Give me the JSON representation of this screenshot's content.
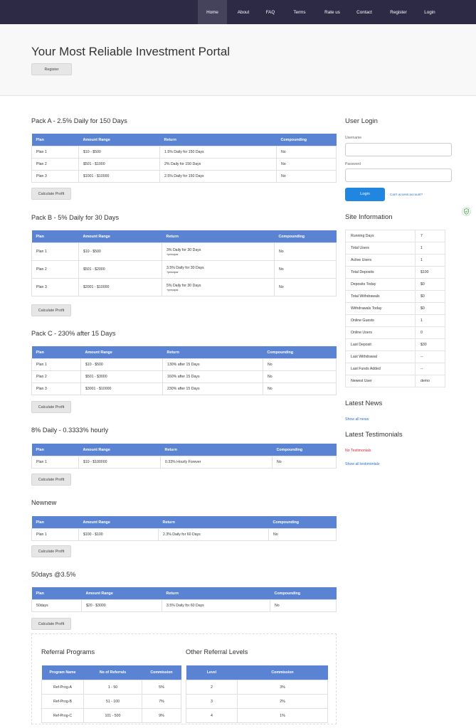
{
  "nav": {
    "items": [
      "Home",
      "About",
      "FAQ",
      "Terms",
      "Rate us",
      "Contact",
      "Register",
      "Login"
    ],
    "active": "Home"
  },
  "hero": {
    "title": "Your Most Reliable Investment Portal",
    "register_label": "Register"
  },
  "plans": [
    {
      "title": "Pack A - 2.5% Daily for 150 Days",
      "headers": [
        "Plan",
        "Amount Range",
        "Return",
        "Compounding"
      ],
      "rows": [
        {
          "plan": "Plan 1",
          "range": "$10 - $500",
          "return": "1.5% Daily for 150 Days",
          "note": "",
          "compounding": "No"
        },
        {
          "plan": "Plan 2",
          "range": "$501 - $1000",
          "return": "2% Daily for 150 Days",
          "note": "",
          "compounding": "No"
        },
        {
          "plan": "Plan 3",
          "range": "$1001 - $10000",
          "return": "2.5% Daily for 150 Days",
          "note": "",
          "compounding": "No"
        }
      ],
      "calc_label": "Calculate Profit"
    },
    {
      "title": "Pack B - 5% Daily for 30 Days",
      "headers": [
        "Plan",
        "Amount Range",
        "Return",
        "Compounding"
      ],
      "rows": [
        {
          "plan": "Plan 1",
          "range": "$10 - $500",
          "return": "3% Daily for 30 Days",
          "note": "+principal",
          "compounding": "No"
        },
        {
          "plan": "Plan 2",
          "range": "$501 - $2000",
          "return": "3.5% Daily for 30 Days",
          "note": "+principal",
          "compounding": "No"
        },
        {
          "plan": "Plan 3",
          "range": "$2001 - $10000",
          "return": "5% Daily for 30 Days",
          "note": "+principal",
          "compounding": "No"
        }
      ],
      "calc_label": "Calculate Profit"
    },
    {
      "title": "Pack C - 230% after 15 Days",
      "headers": [
        "Plan",
        "Amount Range",
        "Return",
        "Compounding"
      ],
      "rows": [
        {
          "plan": "Plan 1",
          "range": "$10 - $500",
          "return": "130% after 15 Days",
          "note": "",
          "compounding": "No"
        },
        {
          "plan": "Plan 2",
          "range": "$501 - $3000",
          "return": "160% after 15 Days",
          "note": "",
          "compounding": "No"
        },
        {
          "plan": "Plan 3",
          "range": "$3001 - $10000",
          "return": "230% after 15 Days",
          "note": "",
          "compounding": "No"
        }
      ],
      "calc_label": "Calculate Profit"
    },
    {
      "title": "8% Daily - 0.3333% hourly",
      "headers": [
        "Plan",
        "Amount Range",
        "Return",
        "Compounding"
      ],
      "rows": [
        {
          "plan": "Plan 1",
          "range": "$10 - $100000",
          "return": "0.33% Hourly Forever",
          "note": "",
          "compounding": "No"
        }
      ],
      "calc_label": "Calculate Profit"
    },
    {
      "title": "Newnew",
      "headers": [
        "Plan",
        "Amount Range",
        "Return",
        "Compounding"
      ],
      "rows": [
        {
          "plan": "Plan 1",
          "range": "$100 - $100",
          "return": "2.3% Daily for 60 Days",
          "note": "",
          "compounding": "No"
        }
      ],
      "calc_label": "Calculate Profit"
    },
    {
      "title": "50days @3.5%",
      "headers": [
        "Plan",
        "Amount Range",
        "Return",
        "Compounding"
      ],
      "rows": [
        {
          "plan": "50days",
          "range": "$20 - $3000",
          "return": "3.5% Daily for 60 Days",
          "note": "",
          "compounding": "No"
        }
      ],
      "calc_label": "Calculate Profit"
    }
  ],
  "login": {
    "title": "User Login",
    "username_label": "Username",
    "password_label": "Password",
    "button_label": "Login",
    "cant_access": "Can't access account?"
  },
  "site_info": {
    "title": "Site Information",
    "rows": [
      {
        "label": "Running Days",
        "value": "7"
      },
      {
        "label": "Total Users",
        "value": "1"
      },
      {
        "label": "Active Users",
        "value": "1"
      },
      {
        "label": "Total Deposits",
        "value": "$100"
      },
      {
        "label": "Deposits Today",
        "value": "$0"
      },
      {
        "label": "Total Withdrawals",
        "value": "$0"
      },
      {
        "label": "Withdrawals Today",
        "value": "$0"
      },
      {
        "label": "Online Guests",
        "value": "1"
      },
      {
        "label": "Online Users",
        "value": "0"
      },
      {
        "label": "Last Deposit",
        "value": "$30"
      },
      {
        "label": "Last Withdrawal",
        "value": "--"
      },
      {
        "label": "Last Funds Added",
        "value": "--"
      },
      {
        "label": "Newest User",
        "value": "demo"
      }
    ]
  },
  "news": {
    "title": "Latest News",
    "show_all": "Show all news"
  },
  "testimonials": {
    "title": "Latest Testimonials",
    "empty": "No Testimonials",
    "show_all": "Show all testimonials"
  },
  "referral": {
    "title": "Referral Programs",
    "headers": [
      "Program Name",
      "No of Referrals",
      "Commission"
    ],
    "rows": [
      [
        "Ref-Prog-A",
        "1 - 50",
        "5%"
      ],
      [
        "Ref-Prog-B",
        "51 - 100",
        "7%"
      ],
      [
        "Ref-Prog-C",
        "101 - 500",
        "9%"
      ]
    ]
  },
  "other_levels": {
    "title": "Other Referral Levels",
    "headers": [
      "Level",
      "Commission"
    ],
    "rows": [
      [
        "2",
        "3%"
      ],
      [
        "3",
        "2%"
      ],
      [
        "4",
        "1%"
      ]
    ]
  },
  "colors": {
    "nav_bg": "#2d2a45",
    "table_header": "#5b83d4",
    "login_button": "#2086e0",
    "link": "#2a6fc4",
    "alert": "#e0263a"
  },
  "icons": {
    "shield": "shield-check-icon"
  }
}
